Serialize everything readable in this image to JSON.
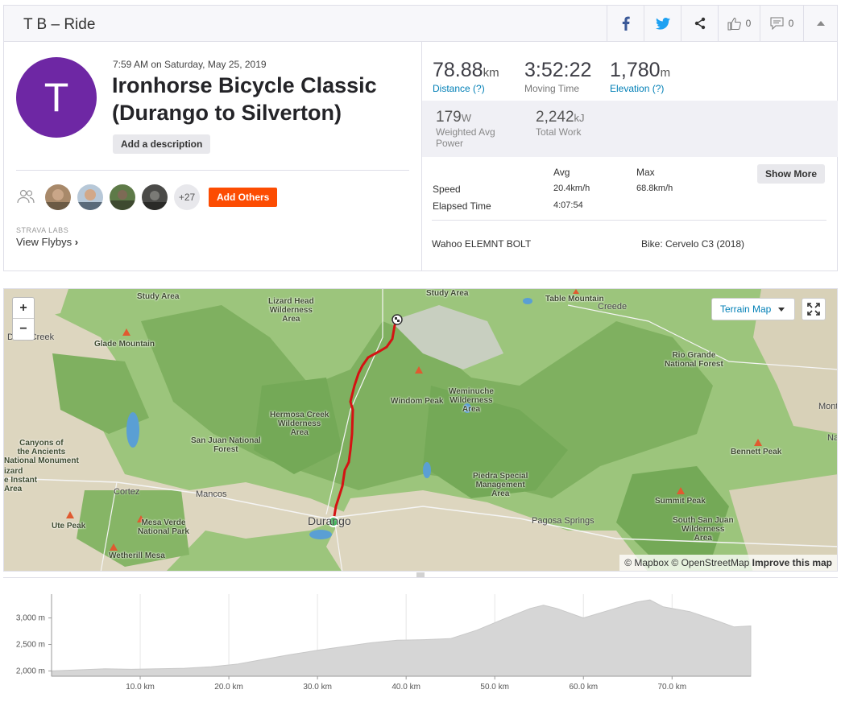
{
  "header": {
    "title": "T B – Ride",
    "kudos_count": "0",
    "comments_count": "0"
  },
  "activity": {
    "avatar_letter": "T",
    "avatar_color": "#6e27a4",
    "date": "7:59 AM on Saturday, May 25, 2019",
    "title": "Ironhorse Bicycle Classic (Durango to Silverton)",
    "add_description_label": "Add a description",
    "athletes_more": "+27",
    "add_others_label": "Add Others",
    "labs_label": "STRAVA LABS",
    "flybys_label": "View Flybys"
  },
  "stats": {
    "distance_value": "78.88",
    "distance_unit": "km",
    "distance_label": "Distance (?)",
    "moving_time_value": "3:52:22",
    "moving_time_label": "Moving Time",
    "elevation_value": "1,780",
    "elevation_unit": "m",
    "elevation_label": "Elevation (?)",
    "power_value": "179",
    "power_unit": "W",
    "power_label_1": "Weighted Avg",
    "power_label_2": "Power",
    "work_value": "2,242",
    "work_unit": "kJ",
    "work_label": "Total Work"
  },
  "details": {
    "col_avg": "Avg",
    "col_max": "Max",
    "show_more_label": "Show More",
    "rows": [
      {
        "label": "Speed",
        "avg": "20.4km/h",
        "max": "68.8km/h"
      },
      {
        "label": "Elapsed Time",
        "avg": "4:07:54",
        "max": ""
      }
    ],
    "device": "Wahoo ELEMNT BOLT",
    "bike": "Bike: Cervelo C3 (2018)"
  },
  "map": {
    "zoom_in": "+",
    "zoom_out": "−",
    "style_label": "Terrain Map",
    "attribution_1": "© Mapbox © OpenStreetMap",
    "attribution_2": "Improve this map",
    "labels": {
      "study_area_left": "Study Area",
      "lizard_head": "Lizard Head\nWilderness\nArea",
      "study_area_top": "Study Area",
      "table_mountain": "Table Mountain",
      "creede": "Creede",
      "dove_creek": "Dove Creek",
      "glade_mountain": "Glade Mountain",
      "rio_grande": "Rio Grande\nNational Forest",
      "windom_peak": "Windom Peak",
      "weminuche": "Weminuche\nWilderness\nArea",
      "hermosa": "Hermosa Creek\nWilderness\nArea",
      "monte": "Mont",
      "na": "Na",
      "canyons": "Canyons of\nthe Ancients\nNational Monument",
      "lizard": "izard",
      "instant": "e Instant",
      "area_left": "Area",
      "san_juan_nf": "San Juan National\nForest",
      "bennett_peak": "Bennett Peak",
      "cortez": "Cortez",
      "mancos": "Mancos",
      "piedra": "Piedra Special\nManagement\nArea",
      "summit_peak": "Summit Peak",
      "ute_peak": "Ute Peak",
      "mesa_verde": "Mesa Verde\nNational Park",
      "durango": "Durango",
      "pagosa": "Pagosa Springs",
      "south_san_juan": "South San Juan\nWilderness\nArea",
      "wetherill": "Wetherill Mesa"
    }
  },
  "elevation_chart": {
    "type": "area",
    "x_unit": "km",
    "xlim": [
      0,
      78.88
    ],
    "ylim": [
      1900,
      3450
    ],
    "x_ticks": [
      "10.0 km",
      "20.0 km",
      "30.0 km",
      "40.0 km",
      "50.0 km",
      "60.0 km",
      "70.0 km"
    ],
    "y_ticks": [
      "3,000 m",
      "2,500 m",
      "2,000 m"
    ],
    "x_tick_values": [
      10,
      20,
      30,
      40,
      50,
      60,
      70
    ],
    "y_tick_values": [
      3000,
      2500,
      2000
    ],
    "x": [
      0,
      3,
      6,
      9,
      12,
      15,
      18,
      21,
      24,
      27,
      30,
      33,
      36,
      39,
      42,
      45,
      48,
      51,
      54,
      55.5,
      57,
      60,
      63,
      66,
      67.5,
      69,
      72,
      75,
      77,
      78.88
    ],
    "y": [
      2000,
      2020,
      2040,
      2030,
      2040,
      2050,
      2080,
      2130,
      2220,
      2310,
      2390,
      2460,
      2530,
      2580,
      2590,
      2610,
      2770,
      2980,
      3180,
      3240,
      3180,
      3000,
      3150,
      3300,
      3340,
      3210,
      3120,
      2950,
      2830,
      2850
    ]
  }
}
